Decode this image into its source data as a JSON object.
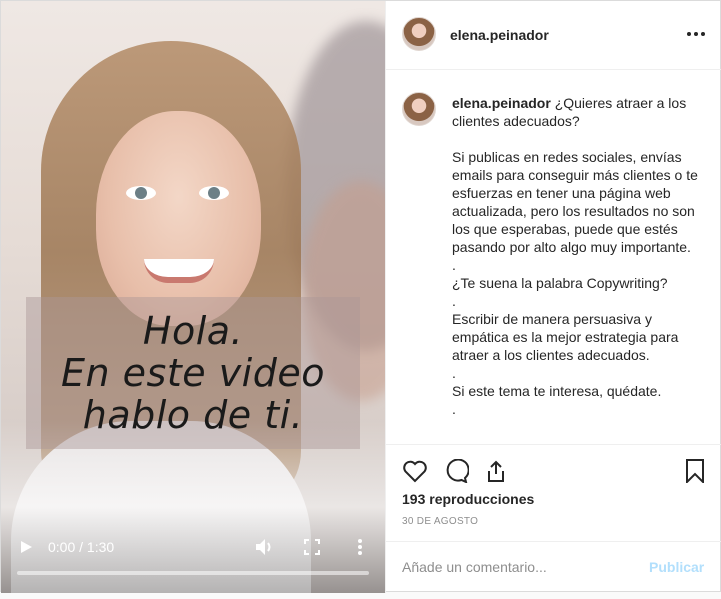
{
  "video": {
    "caption_lines": [
      "Hola.",
      "En este video",
      "hablo de ti."
    ],
    "current_time": "0:00 / 1:30",
    "progress_fraction": 0.0
  },
  "post": {
    "username": "elena.peinador",
    "caption_intro": "¿Quieres atraer a los clientes adecuados?",
    "paragraph_1": "Si publicas en redes sociales, envías emails para conseguir más clientes o te esfuerzas en tener una página web actualizada, pero los resultados no son los que esperabas, puede que estés pasando por alto algo muy importante.",
    "dot": ".",
    "paragraph_2": "¿Te suena la palabra Copywriting?",
    "paragraph_3": "Escribir de manera persuasiva y empática es la mejor estrategia para atraer a los clientes adecuados.",
    "paragraph_4": "Si este tema te interesa, quédate.",
    "views": "193 reproducciones",
    "date": "30 DE AGOSTO"
  },
  "comment_box": {
    "placeholder": "Añade un comentario...",
    "publish_label": "Publicar"
  },
  "colors": {
    "publish_disabled": "#b2dffc",
    "muted_text": "#8e8e8e",
    "border": "#efefef"
  }
}
